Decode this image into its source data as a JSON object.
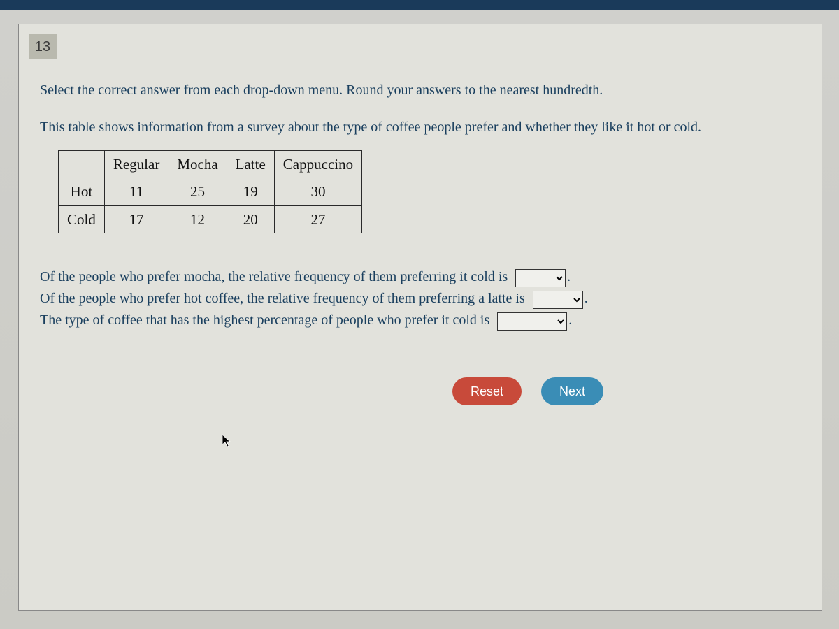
{
  "question_number": "13",
  "instruction": "Select the correct answer from each drop-down menu. Round your answers to the nearest hundredth.",
  "intro": "This table shows information from a survey about the type of coffee people prefer and whether they like it hot or cold.",
  "table": {
    "columns": [
      "Regular",
      "Mocha",
      "Latte",
      "Cappuccino"
    ],
    "rows": [
      {
        "label": "Hot",
        "values": [
          "11",
          "25",
          "19",
          "30"
        ]
      },
      {
        "label": "Cold",
        "values": [
          "17",
          "12",
          "20",
          "27"
        ]
      }
    ]
  },
  "statements": {
    "s1_text": "Of the people who prefer mocha, the relative frequency of them preferring it cold is",
    "s2_text": "Of the people who prefer hot coffee, the relative frequency of them preferring a latte is",
    "s3_text": "The type of coffee that has the highest percentage of people who prefer it cold is",
    "period": "."
  },
  "buttons": {
    "reset": "Reset",
    "next": "Next"
  }
}
